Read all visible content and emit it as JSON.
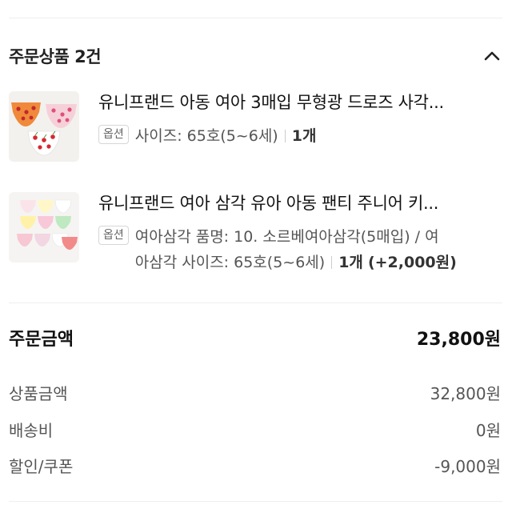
{
  "order_items": {
    "title": "주문상품 2건",
    "items": [
      {
        "name": "유니프랜드 아동 여아 3매입 무형광 드로즈 사각...",
        "option_badge": "옵션",
        "option_text": "사이즈: 65호(5~6세)",
        "quantity": "1개",
        "image": "underwear-product-thumbnail"
      },
      {
        "name": "유니프랜드 여아 삼각 유아 아동 팬티 주니어 키...",
        "option_badge": "옵션",
        "option_text_line1": "여아삼각 품명: 10. 소르베여아삼각(5매입) / 여",
        "option_text_line2": "아삼각 사이즈: 65호(5~6세)",
        "quantity": "1개",
        "extra_price": "(+2,000원)",
        "image": "panties-product-thumbnail"
      }
    ]
  },
  "summary": {
    "total_label": "주문금액",
    "total_value": "23,800원",
    "rows": [
      {
        "label": "상품금액",
        "value": "32,800원"
      },
      {
        "label": "배송비",
        "value": "0원"
      },
      {
        "label": "할인/쿠폰",
        "value": "-9,000원"
      }
    ]
  },
  "colors": {
    "text": "#222222",
    "muted": "#555555",
    "divider": "#eeeeee"
  }
}
